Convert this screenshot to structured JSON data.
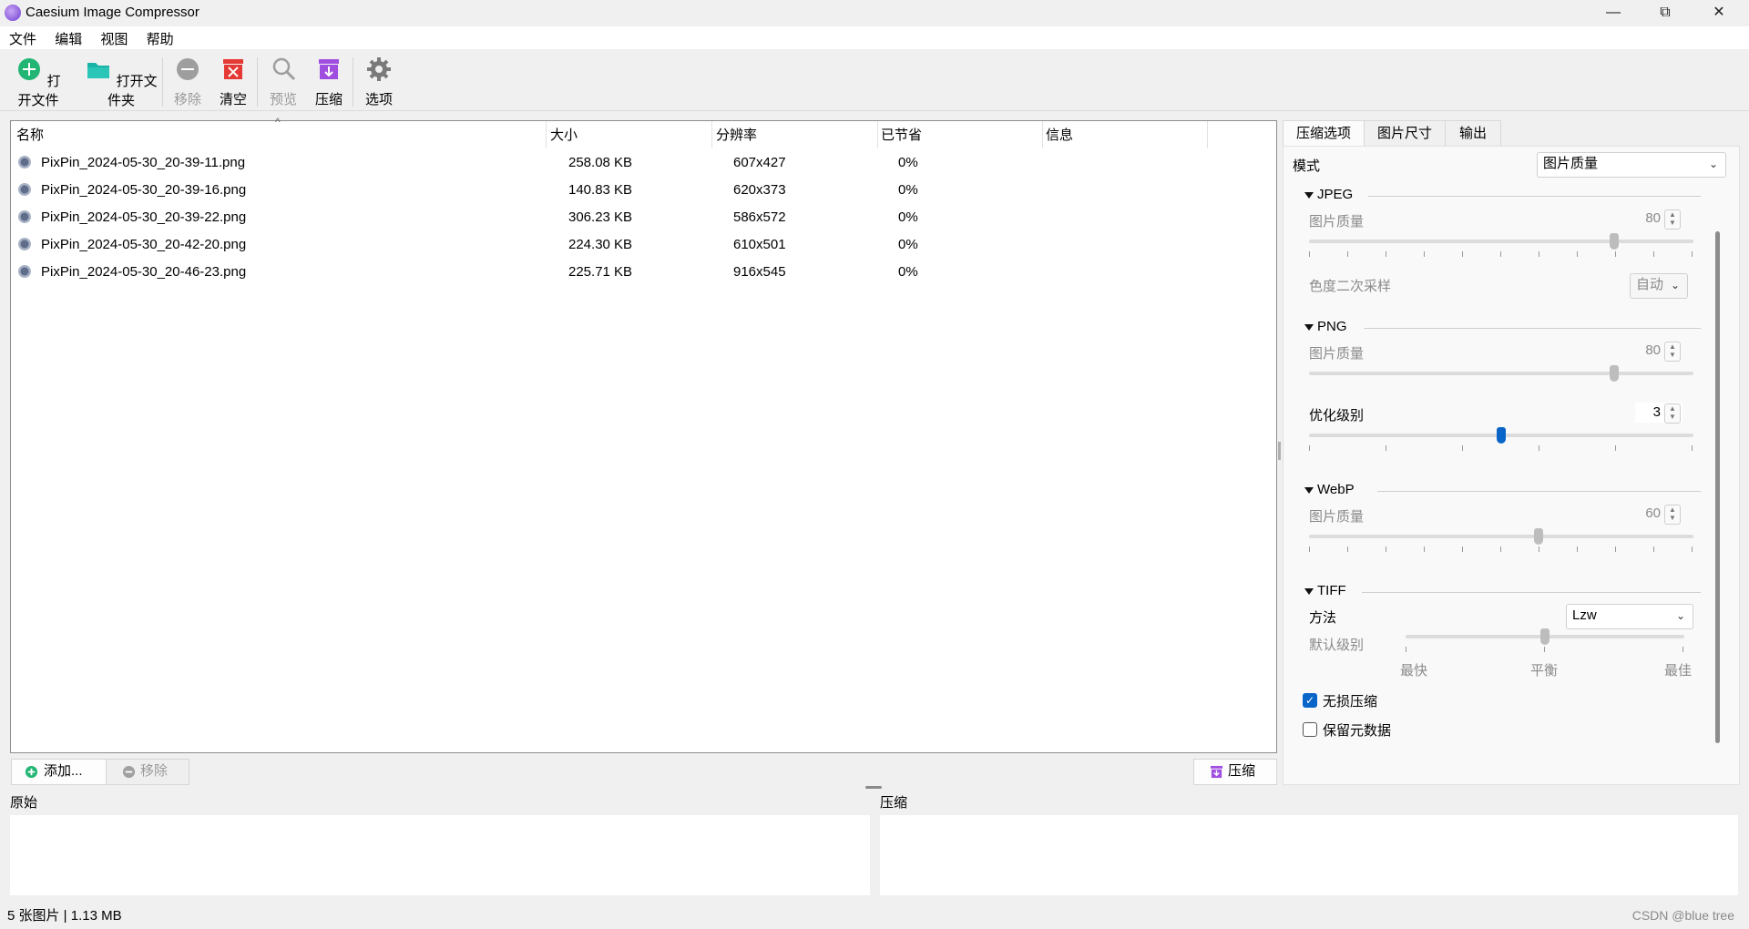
{
  "window": {
    "title": "Caesium Image Compressor",
    "minimize": "—",
    "maximize": "⧉",
    "close": "✕"
  },
  "menu": [
    "文件",
    "编辑",
    "视图",
    "帮助"
  ],
  "toolbar": {
    "open_file": "打开文件",
    "open_folder": "打开文件夹",
    "remove": "移除",
    "clear": "清空",
    "preview": "预览",
    "compress": "压缩",
    "options": "选项"
  },
  "table": {
    "sort_indicator": "^",
    "columns": [
      "名称",
      "大小",
      "分辨率",
      "已节省",
      "信息"
    ],
    "rows": [
      {
        "name": "PixPin_2024-05-30_20-39-11.png",
        "size": "258.08 KB",
        "resolution": "607x427",
        "saved": "0%",
        "info": ""
      },
      {
        "name": "PixPin_2024-05-30_20-39-16.png",
        "size": "140.83 KB",
        "resolution": "620x373",
        "saved": "0%",
        "info": ""
      },
      {
        "name": "PixPin_2024-05-30_20-39-22.png",
        "size": "306.23 KB",
        "resolution": "586x572",
        "saved": "0%",
        "info": ""
      },
      {
        "name": "PixPin_2024-05-30_20-42-20.png",
        "size": "224.30 KB",
        "resolution": "610x501",
        "saved": "0%",
        "info": ""
      },
      {
        "name": "PixPin_2024-05-30_20-46-23.png",
        "size": "225.71 KB",
        "resolution": "916x545",
        "saved": "0%",
        "info": ""
      }
    ]
  },
  "bottom_buttons": {
    "add": "添加...",
    "remove": "移除",
    "compress": "压缩"
  },
  "preview": {
    "original": "原始",
    "compressed": "压缩"
  },
  "status": {
    "summary": "5 张图片 | 1.13 MB",
    "watermark": "CSDN @blue tree"
  },
  "panel": {
    "tabs": [
      "压缩选项",
      "图片尺寸",
      "输出"
    ],
    "mode_label": "模式",
    "mode_value": "图片质量",
    "jpeg": {
      "title": "JPEG",
      "quality_label": "图片质量",
      "quality": "80",
      "subsampling_label": "色度二次采样",
      "subsampling": "自动"
    },
    "png": {
      "title": "PNG",
      "quality_label": "图片质量",
      "quality": "80",
      "opt_label": "优化级别",
      "opt": "3"
    },
    "webp": {
      "title": "WebP",
      "quality_label": "图片质量",
      "quality": "60"
    },
    "tiff": {
      "title": "TIFF",
      "method_label": "方法",
      "method": "Lzw",
      "level_label": "默认级别",
      "level_min": "最快",
      "level_mid": "平衡",
      "level_max": "最佳"
    },
    "lossless": "无损压缩",
    "keep_metadata": "保留元数据",
    "sliders": {
      "jpeg_quality": 0.8,
      "png_quality": 0.8,
      "png_opt": 0.5,
      "webp_quality": 0.6,
      "tiff_level": 0.5
    },
    "checks": {
      "lossless": true,
      "keep_metadata": false
    }
  },
  "colors": {
    "accent": "#0a65c8",
    "add_green": "#22b573",
    "folder_teal": "#1ab3a6",
    "clear_red": "#e53935",
    "compress_purple": "#a04ee0"
  }
}
